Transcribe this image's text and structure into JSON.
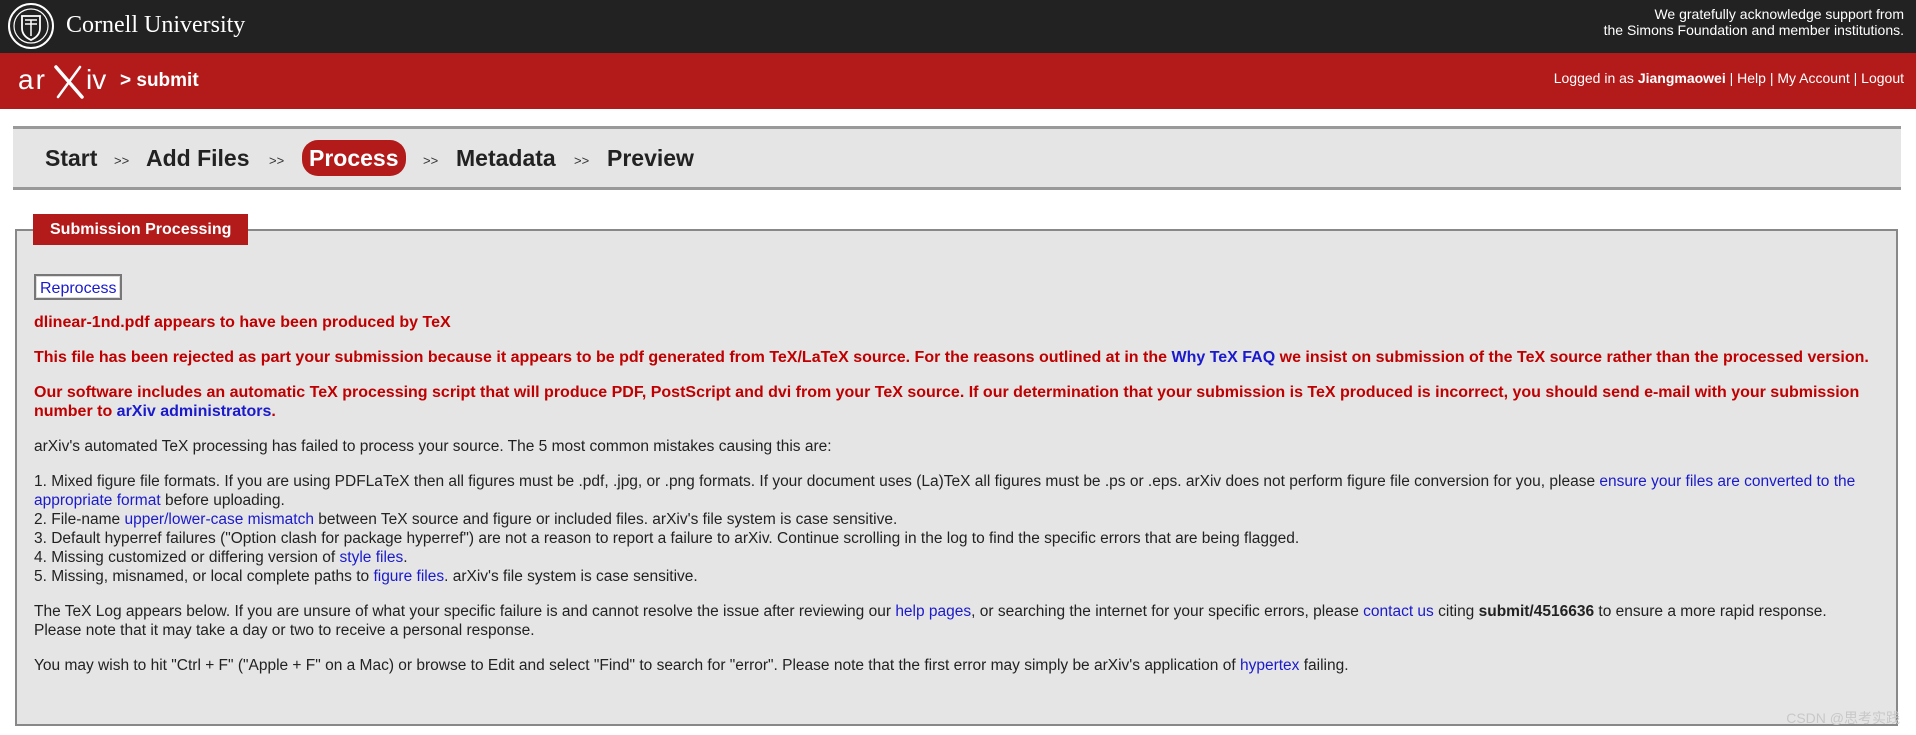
{
  "topbar": {
    "university": "Cornell University",
    "support_line1": "We gratefully acknowledge support from",
    "support_line2": "the Simons Foundation and member institutions."
  },
  "header": {
    "logo_text": "arXiv",
    "crumb": "> submit",
    "logged_in_prefix": "Logged in as ",
    "username": "Jiangmaowei",
    "sep": " | ",
    "help": "Help",
    "account": "My Account",
    "logout": "Logout"
  },
  "steps": {
    "start": "Start",
    "add_files": "Add Files",
    "process": "Process",
    "metadata": "Metadata",
    "preview": "Preview",
    "separator": ">>"
  },
  "panel": {
    "title": "Submission Processing",
    "reprocess": "Reprocess"
  },
  "messages": {
    "produced": "dlinear-1nd.pdf appears to have been produced by TeX",
    "rejected_a": "This file has been rejected as part your submission because it appears to be pdf generated from TeX/LaTeX source. For the reasons outlined at in the ",
    "rejected_link": "Why TeX FAQ",
    "rejected_b": " we insist on submission of the TeX source rather than the processed version.",
    "software_a": "Our software includes an automatic TeX processing script that will produce PDF, PostScript and dvi from your TeX source. If our determination that your submission is TeX produced is incorrect, you should send e-mail with your submission number to ",
    "software_link": "arXiv administrators",
    "software_b": ".",
    "failed": "arXiv's automated TeX processing has failed to process your source. The 5 most common mistakes causing this are:",
    "m1a": "1. Mixed figure file formats. If you are using PDFLaTeX then all figures must be .pdf, .jpg, or .png formats. If your document uses (La)TeX all figures must be .ps or .eps. arXiv does not perform figure file conversion for you, please ",
    "m1link": "ensure your files are converted to the appropriate format",
    "m1b": " before uploading.",
    "m2a": "2. File-name ",
    "m2link": "upper/lower-case mismatch",
    "m2b": " between TeX source and figure or included files. arXiv's file system is case sensitive.",
    "m3": "3. Default hyperref failures (\"Option clash for package hyperref\") are not a reason to report a failure to arXiv. Continue scrolling in the log to find the specific errors that are being flagged.",
    "m4a": "4. Missing customized or differing version of ",
    "m4link": "style files",
    "m4b": ".",
    "m5a": "5. Missing, misnamed, or local complete paths to ",
    "m5link": "figure files",
    "m5b": ". arXiv's file system is case sensitive.",
    "log_a": "The TeX Log appears below. If you are unsure of what your specific failure is and cannot resolve the issue after reviewing our ",
    "log_link1": "help pages",
    "log_b": ", or searching the internet for your specific errors, please ",
    "log_link2": "contact us",
    "log_c": " citing ",
    "submit_id": "submit/4516636",
    "log_d": " to ensure a more rapid response. Please note that it may take a day or two to receive a personal response.",
    "find_a": "You may wish to hit \"Ctrl + F\" (\"Apple + F\" on a Mac) or browse to Edit and select \"Find\" to search for \"error\". Please note that the first error may simply be arXiv's application of ",
    "find_link": "hypertex",
    "find_b": " failing."
  },
  "watermark": "CSDN @思考实践",
  "colors": {
    "arxiv_red": "#b31b1b",
    "topbar": "#222222",
    "link": "#1a1acc",
    "warning": "#c00000"
  }
}
